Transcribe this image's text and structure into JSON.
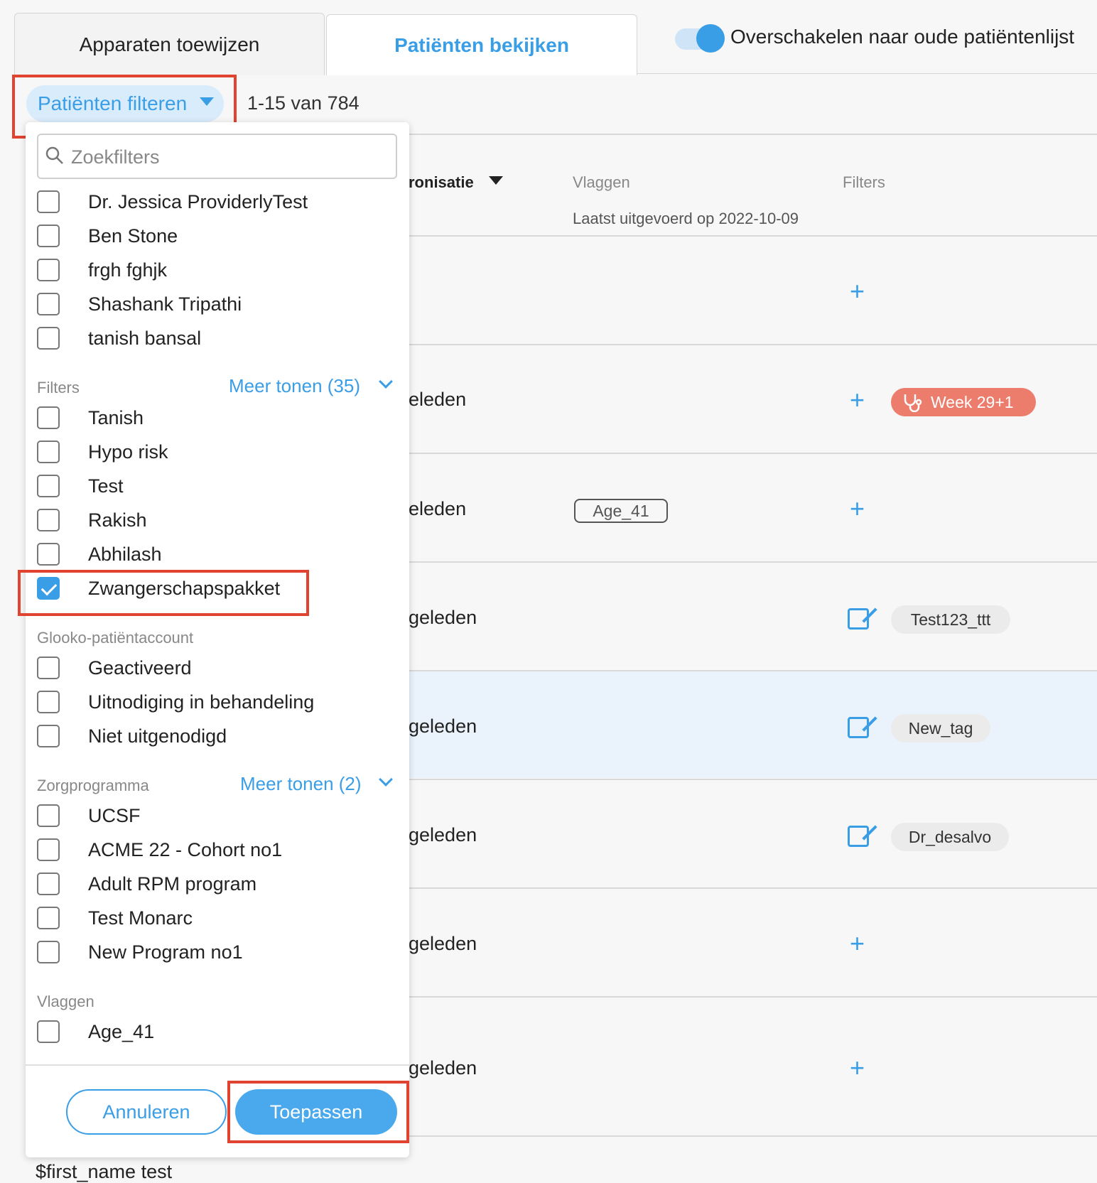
{
  "tabs": {
    "assign_devices": "Apparaten toewijzen",
    "view_patients": "Patiënten bekijken"
  },
  "toggle": {
    "label": "Overschakelen naar oude patiëntenlijst",
    "on": true
  },
  "filter_button": {
    "label": "Patiënten filteren"
  },
  "pagination": {
    "text": "1-15 van 784"
  },
  "table": {
    "headers": {
      "sync": "ronisatie",
      "flags": "Vlaggen",
      "filters": "Filters",
      "last_run": "Laatst uitgevoerd op 2022-10-09"
    },
    "rows": [
      {
        "sync": "",
        "flag": "",
        "tag": "",
        "action": "plus"
      },
      {
        "sync": "eleden",
        "flag": "",
        "tag": "Week 29+1",
        "action": "plus"
      },
      {
        "sync": "eleden",
        "flag": "Age_41",
        "tag": "",
        "action": "plus"
      },
      {
        "sync": "geleden",
        "flag": "",
        "tag": "Test123_ttt",
        "action": "edit"
      },
      {
        "sync": "geleden",
        "flag": "",
        "tag": "New_tag",
        "action": "edit"
      },
      {
        "sync": "geleden",
        "flag": "",
        "tag": "Dr_desalvo",
        "action": "edit"
      },
      {
        "sync": "geleden",
        "flag": "",
        "tag": "",
        "action": "plus"
      },
      {
        "sync": "geleden",
        "flag": "",
        "tag": "",
        "action": "plus"
      }
    ],
    "plus_symbol": "+"
  },
  "dropdown": {
    "search_placeholder": "Zoekfilters",
    "providers": [
      "Dr. Jessica ProviderlyTest",
      "Ben Stone",
      "frgh fghjk",
      "Shashank Tripathi",
      "tanish bansal"
    ],
    "filters_section": {
      "title": "Filters",
      "more": "Meer tonen (35)",
      "items": [
        "Tanish",
        "Hypo risk",
        "Test",
        "Rakish",
        "Abhilash",
        "Zwangerschapspakket"
      ],
      "checked": "Zwangerschapspakket"
    },
    "account_section": {
      "title": "Glooko-patiëntaccount",
      "items": [
        "Geactiveerd",
        "Uitnodiging in behandeling",
        "Niet uitgenodigd"
      ]
    },
    "program_section": {
      "title": "Zorgprogramma",
      "more": "Meer tonen (2)",
      "items": [
        "UCSF",
        "ACME 22 - Cohort no1",
        "Adult RPM program",
        "Test Monarc",
        "New Program no1"
      ]
    },
    "flags_section": {
      "title": "Vlaggen",
      "items": [
        "Age_41"
      ]
    },
    "cancel": "Annuleren",
    "apply": "Toepassen"
  },
  "bottom_row_text": "$first_name test",
  "colors": {
    "accent": "#3a9ee6",
    "highlight": "#e0432f",
    "pregnancy_tag": "#ec7c6c"
  }
}
